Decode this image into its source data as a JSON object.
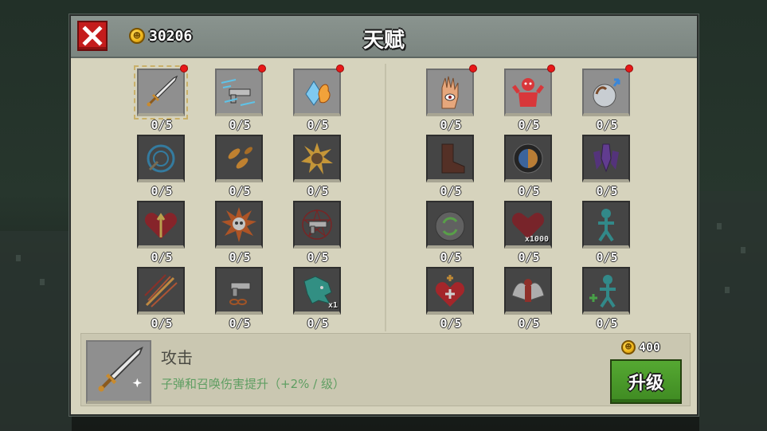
{
  "header": {
    "title": "天赋",
    "coins": "30206"
  },
  "left_talents": [
    {
      "icon": "sword-icon",
      "count": "0/5",
      "unlocked": true,
      "new": true,
      "selected": true
    },
    {
      "icon": "fast-gun-icon",
      "count": "0/5",
      "unlocked": true,
      "new": true
    },
    {
      "icon": "ice-fire-crystal-icon",
      "count": "0/5",
      "unlocked": true,
      "new": true
    },
    {
      "icon": "target-ring-icon",
      "count": "0/5"
    },
    {
      "icon": "flying-bullets-icon",
      "count": "0/5"
    },
    {
      "icon": "explosion-fist-icon",
      "count": "0/5"
    },
    {
      "icon": "heart-arrows-icon",
      "count": "0/5"
    },
    {
      "icon": "skull-burst-icon",
      "count": "0/5"
    },
    {
      "icon": "pistol-pentagram-icon",
      "count": "0/5"
    },
    {
      "icon": "claw-slash-icon",
      "count": "0/5"
    },
    {
      "icon": "pistol-chain-icon",
      "count": "0/5"
    },
    {
      "icon": "dragon-head-icon",
      "count": "0/5",
      "badge": "x1"
    }
  ],
  "right_talents": [
    {
      "icon": "eye-hand-icon",
      "count": "0/5",
      "unlocked": true,
      "new": true
    },
    {
      "icon": "red-demon-icon",
      "count": "0/5",
      "unlocked": true,
      "new": true
    },
    {
      "icon": "hand-orb-icon",
      "count": "0/5",
      "unlocked": true,
      "new": true
    },
    {
      "icon": "boot-icon",
      "count": "0/5"
    },
    {
      "icon": "fire-ice-orb-icon",
      "count": "0/5"
    },
    {
      "icon": "purple-crystals-icon",
      "count": "0/5"
    },
    {
      "icon": "recycle-orb-icon",
      "count": "0/5"
    },
    {
      "icon": "heart-x1000-icon",
      "count": "0/5",
      "badge": "x1000"
    },
    {
      "icon": "stickman-icon",
      "count": "0/5"
    },
    {
      "icon": "sacred-heart-icon",
      "count": "0/5"
    },
    {
      "icon": "winged-demon-icon",
      "count": "0/5"
    },
    {
      "icon": "stickman-plus-icon",
      "count": "0/5"
    }
  ],
  "detail": {
    "name": "攻击",
    "description": "子弹和召唤伤害提升（+2% / 级）",
    "cost": "400",
    "upgrade_label": "升级"
  }
}
